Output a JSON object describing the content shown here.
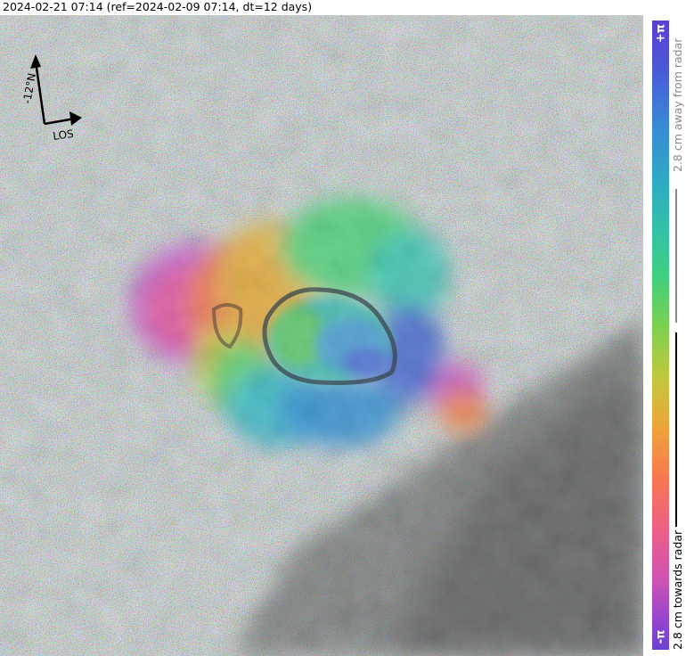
{
  "header": {
    "title": "2024-02-21 07:14 (ref=2024-02-09 07:14, dt=12 days)"
  },
  "compass": {
    "north_label": "-12°N",
    "los_label": "LOS"
  },
  "colorbar": {
    "top_label": "+π",
    "bottom_label": "-π",
    "away_text": "2.8 cm away from radar",
    "towards_text": "2.8 cm towards radar",
    "colors": [
      "#5b3fd1",
      "#3a86d6",
      "#31c1a8",
      "#41d07c",
      "#c2c83b",
      "#f77653",
      "#cf52b2",
      "#6a3fd4"
    ]
  },
  "map": {
    "description_icon": "interferogram-image"
  }
}
